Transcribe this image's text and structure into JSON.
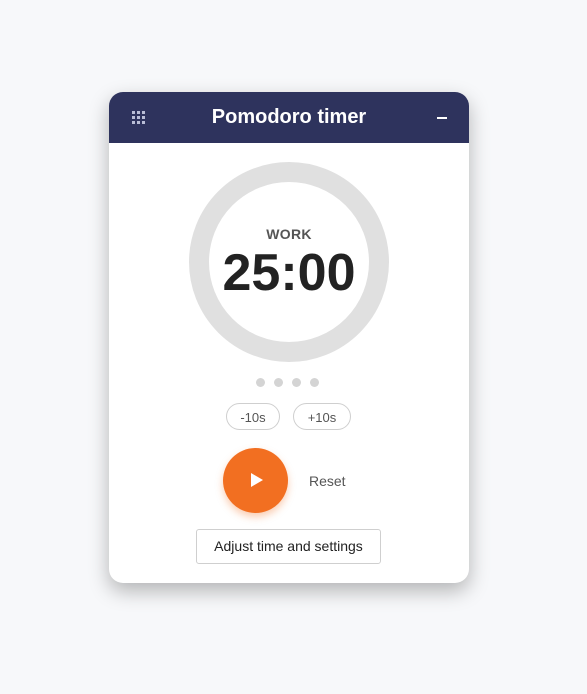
{
  "header": {
    "title": "Pomodoro timer",
    "menu_icon": "grid-icon",
    "minimize_icon": "minimize-icon"
  },
  "timer": {
    "mode": "WORK",
    "time": "25:00",
    "progress": 0,
    "ring_color": "#e0e0e0",
    "session_dots": 4
  },
  "controls": {
    "minus_label": "-10s",
    "plus_label": "+10s",
    "play_icon": "play-icon",
    "reset_label": "Reset",
    "settings_label": "Adjust time and settings"
  },
  "colors": {
    "header_bg": "#2e335d",
    "accent": "#f26f21",
    "dot": "#d4d4d4"
  }
}
